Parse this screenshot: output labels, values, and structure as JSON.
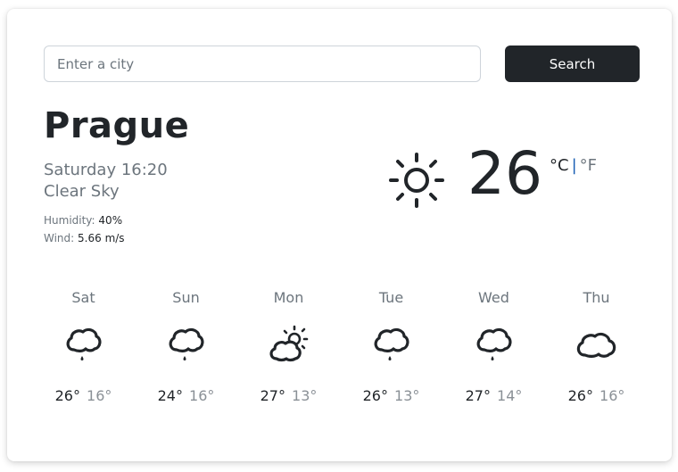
{
  "search": {
    "placeholder": "Enter a city",
    "value": "",
    "button_label": "Search"
  },
  "current": {
    "city": "Prague",
    "datetime": "Saturday 16:20",
    "description": "Clear Sky",
    "humidity_label": "Humidity:",
    "humidity_value": "40%",
    "wind_label": "Wind:",
    "wind_value": "5.66 m/s",
    "icon": "sun-icon",
    "temperature": "26",
    "unit_celsius": "°C",
    "unit_separator": "|",
    "unit_fahrenheit": "°F"
  },
  "forecast": [
    {
      "day": "Sat",
      "icon": "rain-cloud-icon",
      "high": "26°",
      "low": "16°"
    },
    {
      "day": "Sun",
      "icon": "rain-cloud-icon",
      "high": "24°",
      "low": "16°"
    },
    {
      "day": "Mon",
      "icon": "partly-sunny-icon",
      "high": "27°",
      "low": "13°"
    },
    {
      "day": "Tue",
      "icon": "rain-cloud-icon",
      "high": "26°",
      "low": "13°"
    },
    {
      "day": "Wed",
      "icon": "rain-cloud-icon",
      "high": "27°",
      "low": "14°"
    },
    {
      "day": "Thu",
      "icon": "cloud-icon",
      "high": "26°",
      "low": "16°"
    }
  ]
}
